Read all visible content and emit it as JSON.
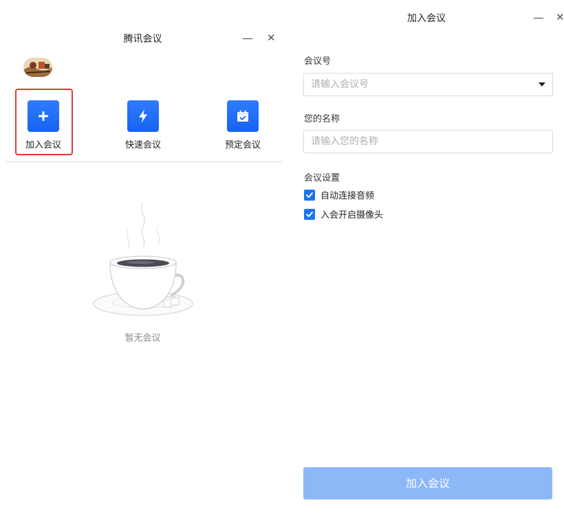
{
  "left_window": {
    "title": "腾讯会议",
    "minimize": "—",
    "close": "✕",
    "actions": [
      {
        "label": "加入会议",
        "icon": "plus-icon"
      },
      {
        "label": "快速会议",
        "icon": "lightning-icon"
      },
      {
        "label": "预定会议",
        "icon": "calendar-icon"
      }
    ],
    "empty_state": "暂无会议"
  },
  "right_window": {
    "title": "加入会议",
    "minimize": "—",
    "close": "✕",
    "meeting_id": {
      "label": "会议号",
      "placeholder": "请输入会议号"
    },
    "your_name": {
      "label": "您的名称",
      "placeholder": "请输入您的名称"
    },
    "settings_label": "会议设置",
    "options": [
      {
        "label": "自动连接音频",
        "checked": true
      },
      {
        "label": "入会开启摄像头",
        "checked": true
      }
    ],
    "join_button": "加入会议"
  },
  "colors": {
    "accent": "#1a73f5",
    "tile_blue": "#2f7bff",
    "highlight_red": "#e23a2e",
    "button_disabled": "#8cb8f8"
  }
}
